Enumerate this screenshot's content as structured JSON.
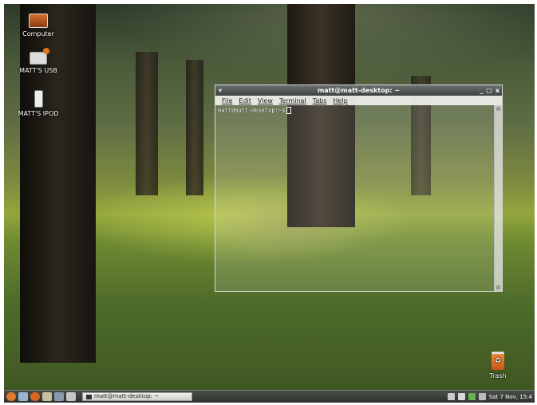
{
  "desktop": {
    "icons": [
      {
        "label": "Computer",
        "icon": "computer-icon"
      },
      {
        "label": "MATT'S USB",
        "icon": "usb-drive-icon"
      },
      {
        "label": "MATT'S IPOD",
        "icon": "ipod-icon"
      }
    ],
    "trash": {
      "label": "Trash",
      "icon": "trash-icon"
    }
  },
  "terminal": {
    "title": "matt@matt-desktop: ~",
    "menu": [
      "File",
      "Edit",
      "View",
      "Terminal",
      "Tabs",
      "Help"
    ],
    "prompt": "matt@matt-desktop:~$",
    "controls": [
      "_",
      "□",
      "x"
    ]
  },
  "panel": {
    "task_label": "matt@matt-desktop: ~",
    "clock": "Sat 7 Nov, 15:4"
  },
  "colors": {
    "panel": "#3a3e3a",
    "title_bar": "#4e5252",
    "accent": "#e07a2b"
  }
}
